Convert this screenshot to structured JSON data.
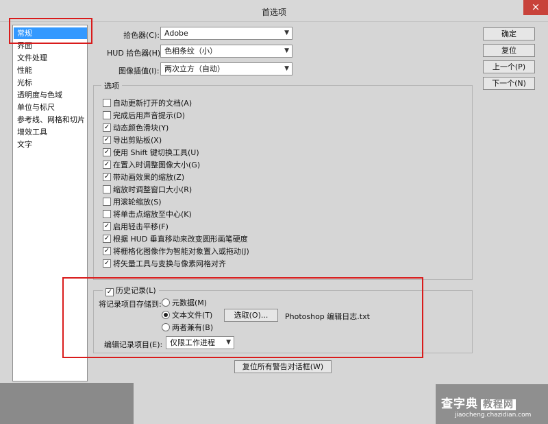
{
  "window": {
    "title": "首选项",
    "close": "×"
  },
  "nav": {
    "items": [
      "常规",
      "界面",
      "文件处理",
      "性能",
      "光标",
      "透明度与色域",
      "单位与标尺",
      "参考线、网格和切片",
      "增效工具",
      "文字"
    ],
    "selected": "常规"
  },
  "pickers": {
    "color_picker_label": "拾色器(C):",
    "color_picker_value": "Adobe",
    "hud_picker_label": "HUD 拾色器(H):",
    "hud_picker_value": "色相条纹（小）",
    "interp_label": "图像插值(I):",
    "interp_value": "两次立方（自动）"
  },
  "options": {
    "legend": "选项",
    "items": [
      {
        "label": "自动更新打开的文档(A)",
        "checked": false
      },
      {
        "label": "完成后用声音提示(D)",
        "checked": false
      },
      {
        "label": "动态颜色滑块(Y)",
        "checked": true
      },
      {
        "label": "导出剪贴板(X)",
        "checked": true
      },
      {
        "label": "使用 Shift 键切换工具(U)",
        "checked": true
      },
      {
        "label": "在置入时调整图像大小(G)",
        "checked": true
      },
      {
        "label": "带动画效果的缩放(Z)",
        "checked": true
      },
      {
        "label": "缩放时调整窗口大小(R)",
        "checked": false
      },
      {
        "label": "用滚轮缩放(S)",
        "checked": false
      },
      {
        "label": "将单击点缩放至中心(K)",
        "checked": false
      },
      {
        "label": "启用轻击平移(F)",
        "checked": true
      },
      {
        "label": "根据 HUD 垂直移动来改变圆形画笔硬度",
        "checked": true
      },
      {
        "label": "将栅格化图像作为智能对象置入或拖动(J)",
        "checked": true
      },
      {
        "label": "将矢量工具与变换与像素网格对齐",
        "checked": true
      }
    ]
  },
  "history": {
    "legend": "历史记录(L)",
    "checked": true,
    "save_to_label": "将记录项目存储到:",
    "radios": [
      {
        "label": "元数据(M)",
        "selected": false
      },
      {
        "label": "文本文件(T)",
        "selected": true
      },
      {
        "label": "两者兼有(B)",
        "selected": false
      }
    ],
    "choose_button": "选取(O)...",
    "file_name": "Photoshop 编辑日志.txt",
    "edit_log_label": "编辑记录项目(E):",
    "edit_log_value": "仅限工作进程"
  },
  "reset_warnings_button": "复位所有警告对话框(W)",
  "buttons": {
    "ok": "确定",
    "reset": "复位",
    "prev": "上一个(P)",
    "next": "下一个(N)"
  },
  "watermark": {
    "title": "查字典",
    "tag": "教程网",
    "url": "jiaocheng.chazidian.com"
  },
  "colors": {
    "selection": "#3399ff",
    "highlight": "#d91b1b",
    "dialog_bg": "#d6d6d6"
  }
}
